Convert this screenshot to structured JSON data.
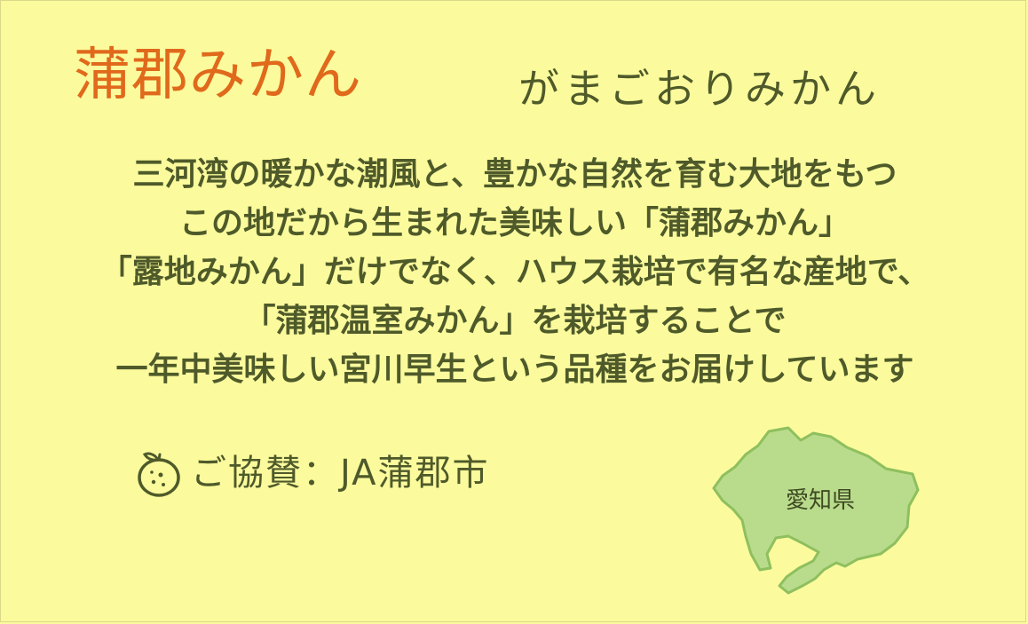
{
  "heading": {
    "title": "蒲郡みかん",
    "reading": "がまごおりみかん"
  },
  "description": {
    "lines": [
      "三河湾の暖かな潮風と、豊かな自然を育む大地をもつ",
      "この地だから生まれた美味しい「蒲郡みかん」",
      "「露地みかん」だけでなく、ハウス栽培で有名な産地で、",
      "「蒲郡温室みかん」を栽培することで",
      "一年中美味しい宮川早生という品種をお届けしています"
    ]
  },
  "sponsor": {
    "icon": "mikan-orange-icon",
    "text": "ご協賛：JA蒲郡市"
  },
  "map": {
    "icon": "aichi-prefecture-map",
    "label": "愛知県"
  },
  "colors": {
    "background": "#fbfb9d",
    "title": "#e0691c",
    "text": "#4f5a2a",
    "map_fill": "#b9dc8c",
    "map_stroke": "#8fbf5e"
  }
}
